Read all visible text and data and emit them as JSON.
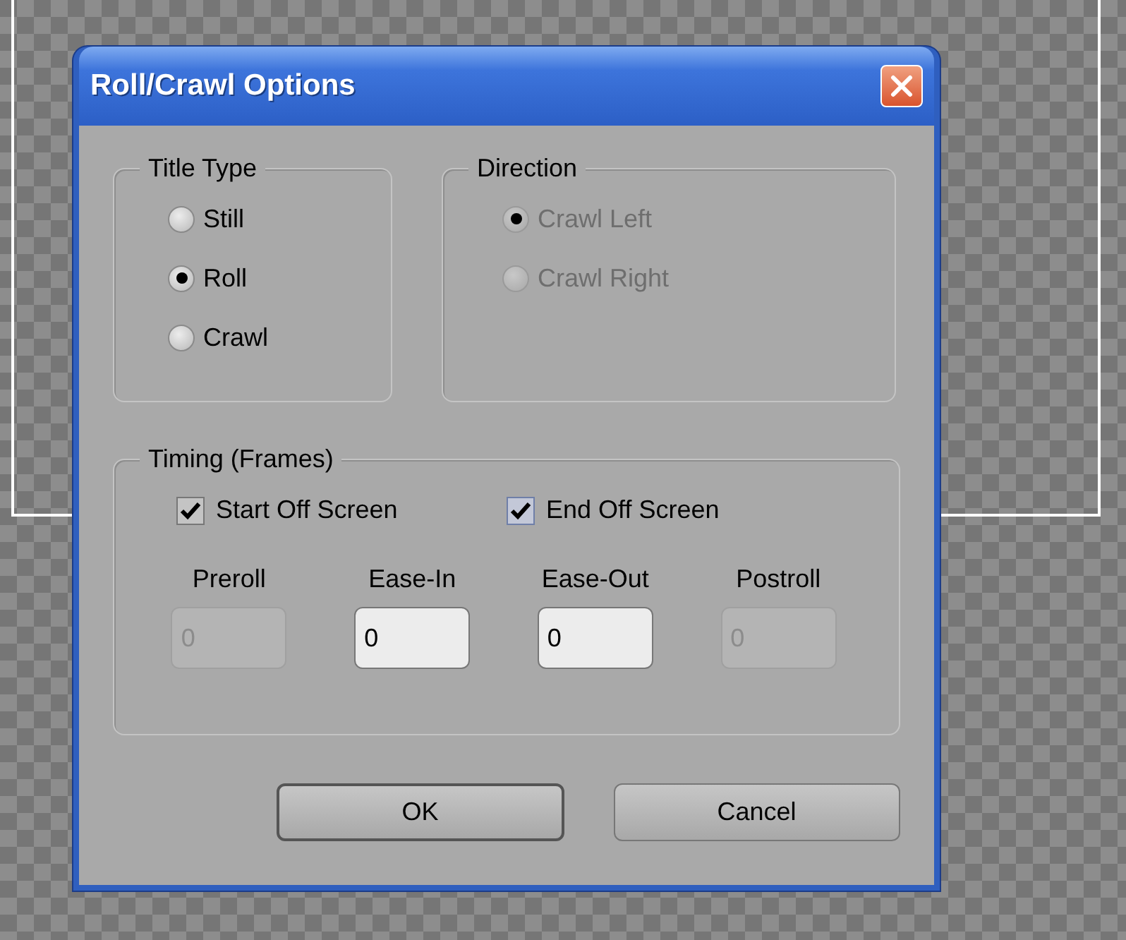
{
  "window": {
    "title": "Roll/Crawl Options"
  },
  "title_type": {
    "label": "Title Type",
    "options": [
      {
        "label": "Still",
        "selected": false
      },
      {
        "label": "Roll",
        "selected": true
      },
      {
        "label": "Crawl",
        "selected": false
      }
    ]
  },
  "direction": {
    "label": "Direction",
    "disabled": true,
    "options": [
      {
        "label": "Crawl Left",
        "selected": true
      },
      {
        "label": "Crawl Right",
        "selected": false
      }
    ]
  },
  "timing": {
    "label": "Timing (Frames)",
    "checkboxes": [
      {
        "label": "Start Off Screen",
        "checked": true
      },
      {
        "label": "End Off Screen",
        "checked": true
      }
    ],
    "fields": [
      {
        "label": "Preroll",
        "value": "0",
        "disabled": true
      },
      {
        "label": "Ease-In",
        "value": "0",
        "disabled": false
      },
      {
        "label": "Ease-Out",
        "value": "0",
        "disabled": false
      },
      {
        "label": "Postroll",
        "value": "0",
        "disabled": true
      }
    ]
  },
  "buttons": [
    {
      "label": "OK",
      "default": true
    },
    {
      "label": "Cancel",
      "default": false
    }
  ]
}
